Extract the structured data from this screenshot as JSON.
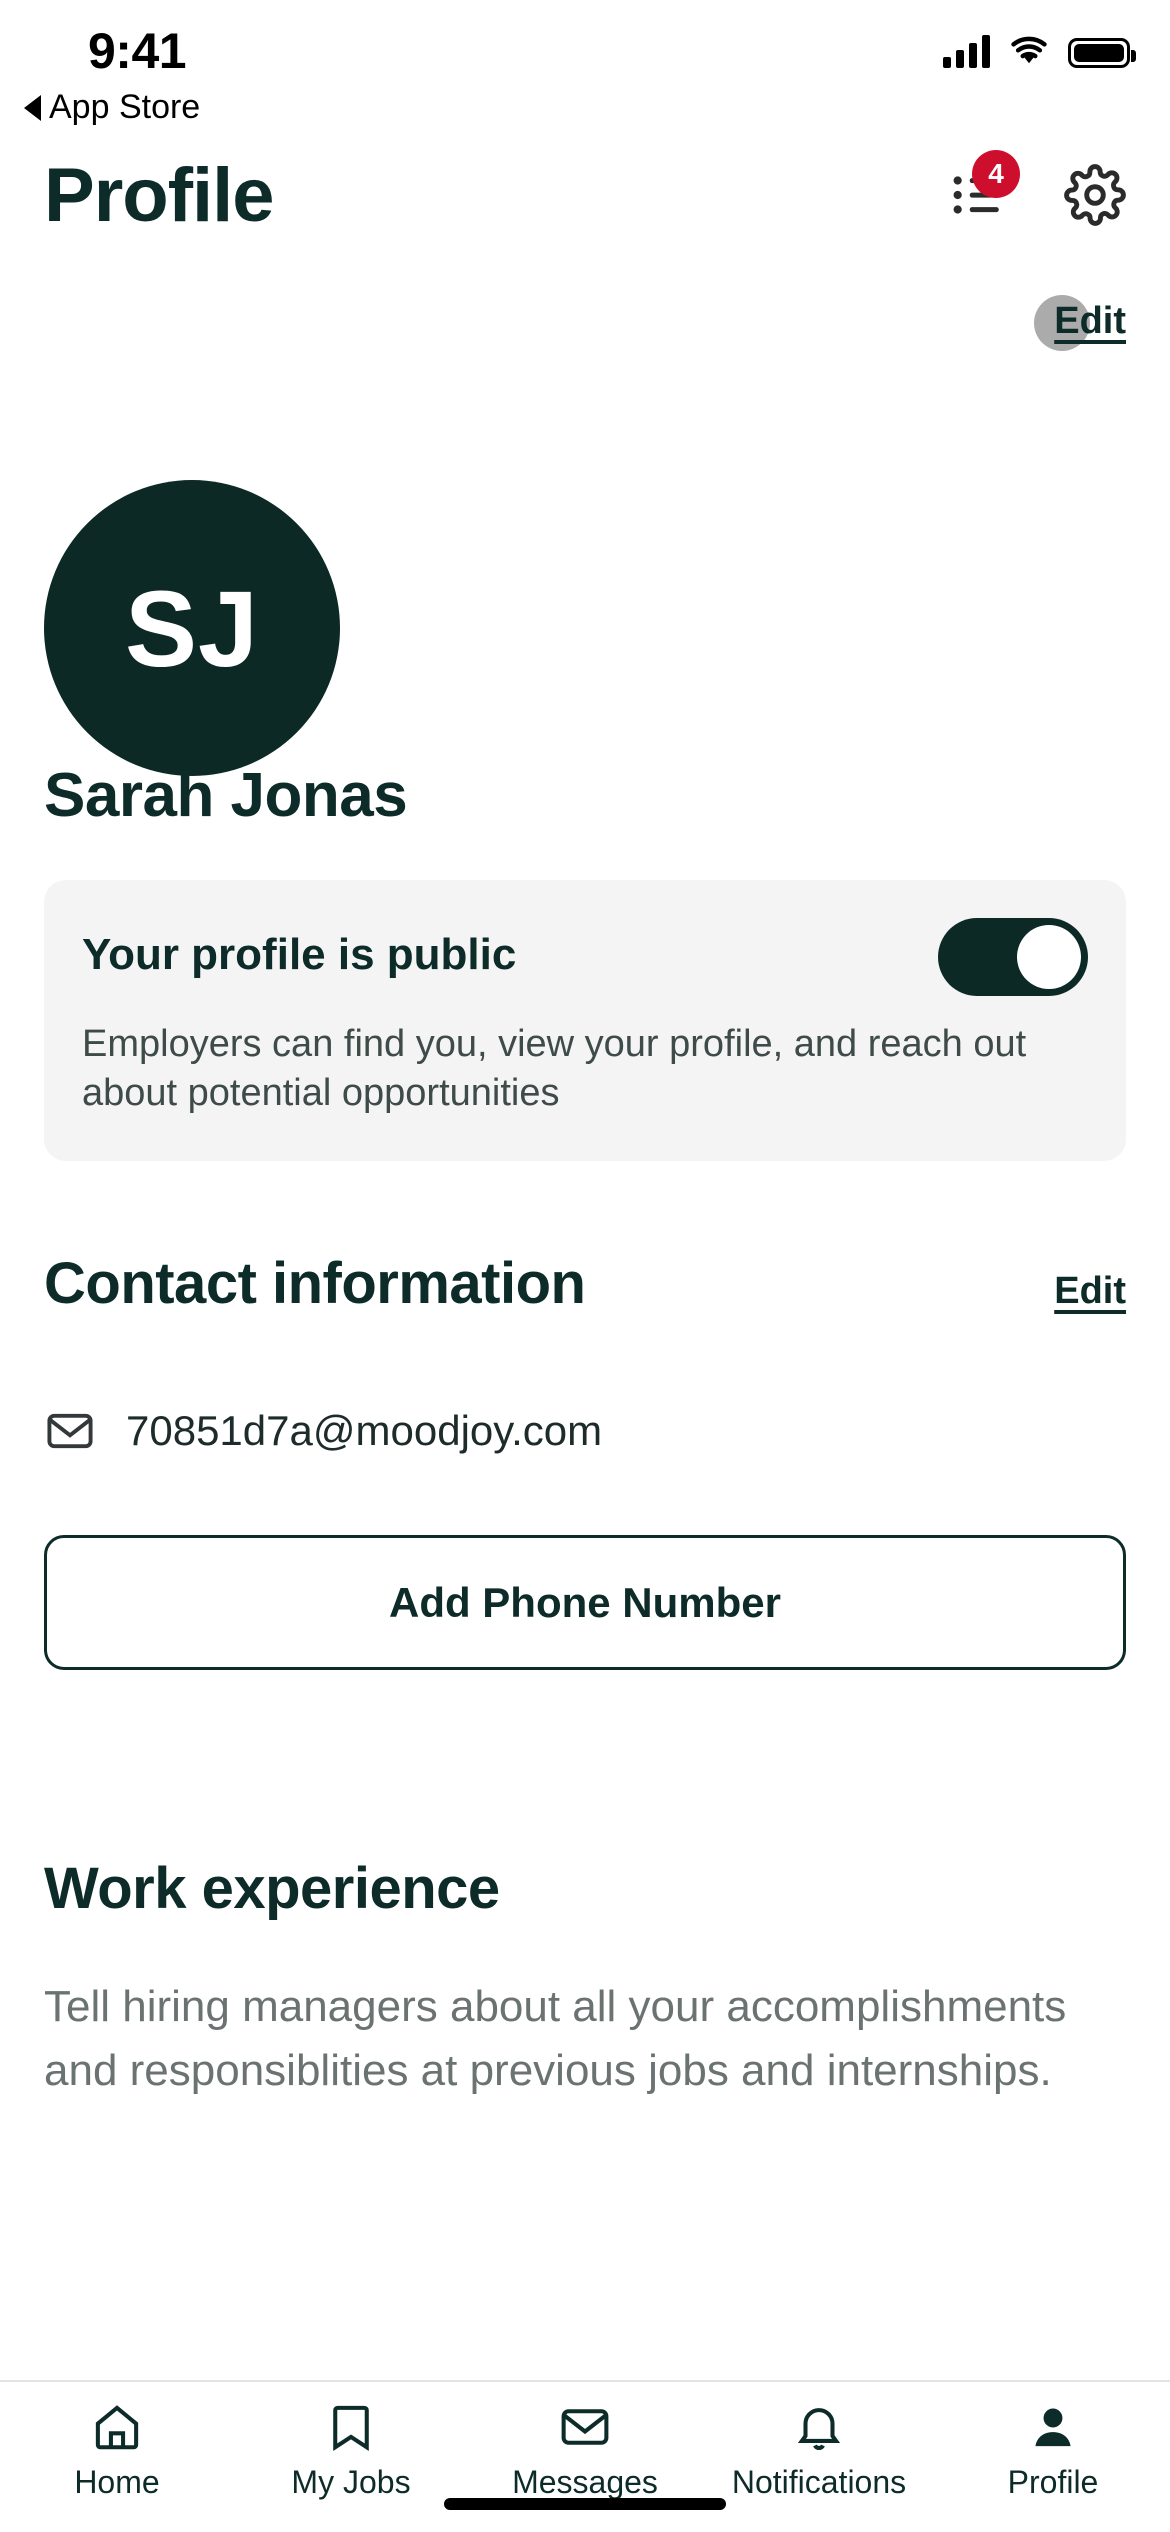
{
  "status_bar": {
    "time": "9:41",
    "back_label": "App Store",
    "back_icon": "triangle-left-icon",
    "signal_icon": "cellular-signal-icon",
    "wifi_icon": "wifi-icon",
    "battery_icon": "battery-full-icon"
  },
  "header": {
    "title": "Profile",
    "activity_icon": "list-activity-icon",
    "activity_badge": "4",
    "settings_icon": "gear-icon"
  },
  "profile": {
    "avatar_initials": "SJ",
    "name": "Sarah Jonas",
    "edit_label": "Edit"
  },
  "public_card": {
    "title": "Your profile is public",
    "description": "Employers can find you, view your profile, and reach out about potential opportunities",
    "toggle_state": "on",
    "toggle_name": "profile-public-toggle"
  },
  "contact": {
    "section_title": "Contact information",
    "edit_label": "Edit",
    "email": "70851d7a@moodjoy.com",
    "email_icon": "envelope-icon",
    "add_phone_label": "Add Phone Number"
  },
  "work": {
    "section_title": "Work experience",
    "description": "Tell hiring managers about all your accomplishments and responsiblities at previous jobs and internships."
  },
  "tabs": [
    {
      "label": "Home",
      "icon": "home-icon",
      "active": false
    },
    {
      "label": "My Jobs",
      "icon": "bookmark-icon",
      "active": false
    },
    {
      "label": "Messages",
      "icon": "envelope-icon",
      "active": false
    },
    {
      "label": "Notifications",
      "icon": "bell-icon",
      "active": false
    },
    {
      "label": "Profile",
      "icon": "person-filled-icon",
      "active": true
    }
  ],
  "colors": {
    "brand_dark": "#0D2B28",
    "avatar_bg": "#0D2926",
    "badge_red": "#CE0E2D",
    "card_bg": "#F4F4F5",
    "muted_text": "#6B7372"
  }
}
